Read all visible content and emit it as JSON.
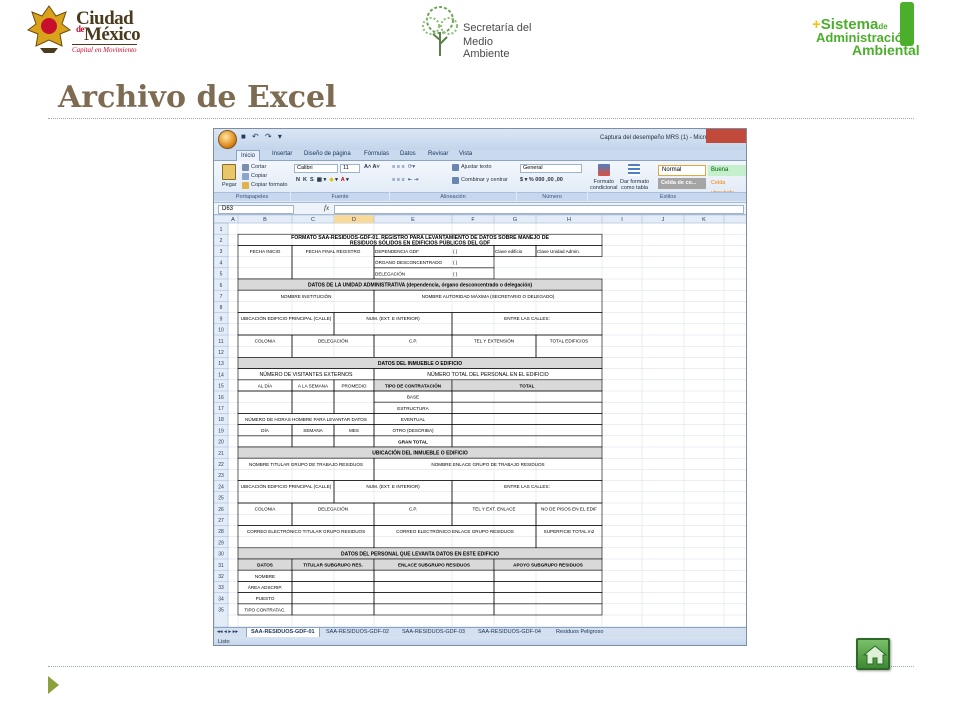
{
  "slide": {
    "title": "Archivo de Excel",
    "logos": {
      "cdmx": {
        "line1": "Ciudad",
        "line2_de": "de",
        "line2": "México",
        "tagline": "Capital en Movimiento"
      },
      "sma": {
        "line1": "Secretaría del",
        "line2": "Medio Ambiente"
      },
      "saa": {
        "plus": "+",
        "word1": "Sistema",
        "word1_small": "de",
        "word2": "Administración",
        "word3": "Ambiental"
      }
    },
    "colors": {
      "title": "#7d6b52",
      "bullet": "#8ba23c",
      "home_button": "#4a9a3e"
    }
  },
  "excel": {
    "window_caption": "Captura del desempeño MRS (1) - Microsoft Excel",
    "tabs": [
      "Inicio",
      "Insertar",
      "Diseño de página",
      "Fórmulas",
      "Datos",
      "Revisar",
      "Vista"
    ],
    "active_tab": "Inicio",
    "ribbon": {
      "paste": "Pegar",
      "cut": "Cortar",
      "copy": "Copiar",
      "format_copy": "Copiar formato",
      "font_name": "Calibri",
      "font_size": "11",
      "wrap_text": "Ajustar texto",
      "merge_center": "Combinar y centrar",
      "number_format": "General",
      "cond_format_1": "Formato",
      "cond_format_2": "condicional",
      "table_format_1": "Dar formato",
      "table_format_2": "como tabla",
      "style_normal": "Normal",
      "style_good": "Buena",
      "style_check": "Celda de co...",
      "style_linked": "Celda vinculada",
      "groups": [
        "Portapapeles",
        "Fuente",
        "Alineación",
        "Número",
        "Estilos"
      ]
    },
    "name_box": "D63",
    "fx": "fx",
    "columns": [
      "A",
      "B",
      "C",
      "D",
      "E",
      "F",
      "G",
      "H",
      "I",
      "J",
      "K"
    ],
    "selected_column": "D",
    "rows": [
      "1",
      "2",
      "3",
      "4",
      "5",
      "6",
      "7",
      "8",
      "9",
      "10",
      "11",
      "12",
      "13",
      "14",
      "15",
      "16",
      "17",
      "18",
      "19",
      "20",
      "21",
      "22",
      "23",
      "24",
      "25",
      "26",
      "27",
      "28",
      "29",
      "30",
      "31",
      "32",
      "33",
      "34",
      "35"
    ],
    "form": {
      "title_line1": "FORMATO SAA-RESIDUOS-GDF-01. REGISTRO PARA LEVANTAMIENTO DE DATOS SOBRE MANEJO DE",
      "title_line2": "RESIDUOS SÓLIDOS EN EDIFICIOS PÚBLICOS DEL GDF",
      "fecha_inicio": "FECHA INICIO",
      "fecha_final": "FECHA FINAL REGISTRO",
      "dependencia": "DEPENDENCIA GDF",
      "organo": "ÓRGANO DESCONCENTRADO",
      "delegacion_opt": "DELEGACIÓN",
      "paren": "(        )",
      "clave_edificio": "Clave edificio",
      "clave_unidad": "Clave Unidad Admin.",
      "sec_unidad": "DATOS DE LA UNIDAD ADMINISTRATIVA (dependencia, órgano desconcentrado o delegación)",
      "nombre_institucion": "NOMBRE INSTITUCIÓN",
      "nombre_autoridad": "NOMBRE AUTORIDAD MÁXIMA (SECRETARIO O DELEGADO)",
      "ubicacion_edificio": "UBICACIÓN EDIFICIO PRINCIPAL (CALLE)",
      "num_ext": "NUM. (EXT. E INTERIOR)",
      "entre_calles": "ENTRE LAS CALLES:",
      "colonia": "COLONIA",
      "delegacion": "DELEGACIÓN",
      "cp": "C.P.",
      "tel_ext": "TEL Y EXTENSIÓN",
      "total_edificios": "TOTAL EDIFICIOS",
      "sec_inmueble": "DATOS DEL INMUEBLE O EDIFICIO",
      "visitantes": "NÚMERO DE VISITANTES EXTERNOS",
      "total_personal": "NÚMERO TOTAL DEL PERSONAL EN EL EDIFICIO",
      "al_dia": "AL DÍA",
      "a_la_semana": "A LA SEMANA",
      "promedio": "PROMEDIO",
      "tipo_contratacion": "TIPO DE CONTRATACIÓN",
      "total": "TOTAL",
      "base": "BASE",
      "estructura": "ESTRUCTURA",
      "horas_hombre": "NÚMERO DE HORAS HOMBRE PARA LEVANTAR DATOS",
      "eventual": "EVENTUAL",
      "dia": "DÍA",
      "semana": "SEMANA",
      "mes": "MES",
      "otro": "OTRO (DESCRIBA)",
      "gran_total": "GRAN TOTAL",
      "sec_ubicacion": "UBICACIÓN DEL INMUEBLE O EDIFICIO",
      "nombre_titular": "NOMBRE TITULAR  GRUPO DE TRABAJO RESIDUOS",
      "nombre_enlace": "NOMBRE ENLACE GRUPO DE TRABAJO RESIDUOS",
      "tel_enlace": "TEL Y EXT. ENLACE",
      "pisos": "NO DE PISOS EN EL EDIF",
      "correo_titular": "CORREO ELECTRÓNICO TITULAR GRUPO RESIDUOS",
      "correo_enlace": "CORREO ELECTRÓNICO ENLACE GRUPO RESIDUOS",
      "superficie": "SUPERFICIE TOTAL m2",
      "sec_personal": "DATOS DEL PERSONAL QUE LEVANTA DATOS EN ESTE EDIFICIO",
      "datos": "DATOS",
      "titular_sub": "TITULAR SUBGRUPO RES.",
      "enlace_sub": "ENLACE SUBGRUPO RESIDUOS",
      "apoyo_sub": "APOYO SUBGRUPO RESIDUOS",
      "nombre": "NOMBRE",
      "area_adscrip": "ÁREA ADSCRIP.",
      "puesto": "PUESTO",
      "tipo_contratac": "TIPO CONTRATAC."
    },
    "sheet_tabs": [
      "SAA-RESIDUOS-GDF-01",
      "SAA-RESIDUOS-GDF-02",
      "SAA-RESIDUOS-GDF-03",
      "SAA-RESIDUOS-GDF-04",
      "Residuos Peligroso"
    ],
    "active_sheet": "SAA-RESIDUOS-GDF-01",
    "status": "Listo"
  }
}
